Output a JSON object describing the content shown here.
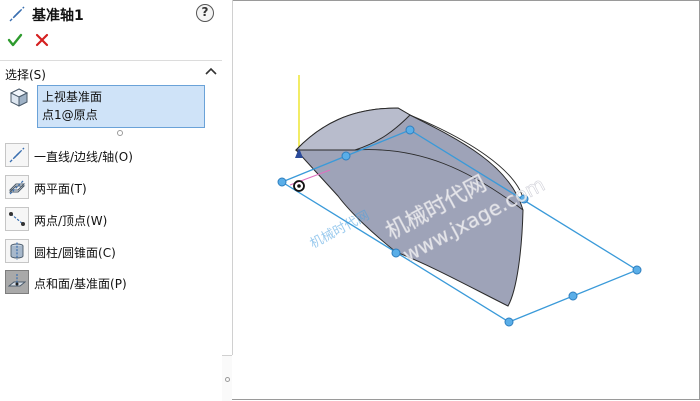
{
  "panel": {
    "title": "基准轴1",
    "help_icon_glyph": "?",
    "section_title": "选择(S)",
    "selections": [
      "上视基准面",
      "点1@原点"
    ],
    "options": [
      {
        "label": "一直线/边线/轴(O)",
        "icon": "line-icon",
        "active": false
      },
      {
        "label": "两平面(T)",
        "icon": "two-planes-icon",
        "active": false
      },
      {
        "label": "两点/顶点(W)",
        "icon": "two-points-icon",
        "active": false
      },
      {
        "label": "圆柱/圆锥面(C)",
        "icon": "cylinder-icon",
        "active": false
      },
      {
        "label": "点和面/基准面(P)",
        "icon": "point-plane-icon",
        "active": true
      }
    ]
  },
  "viewport": {
    "watermark_logo": "机械时代网",
    "watermark_line1": "机械时代网",
    "watermark_line2": "www.jxage.com"
  },
  "colors": {
    "accent": "#3a9ad9",
    "handle": "#5aaee8",
    "surface": "#9ea3b8",
    "axis_yellow": "#e8e000",
    "ok_green": "#2e9b2e",
    "cancel_red": "#d42020",
    "selection_bg": "#cfe3f8"
  }
}
